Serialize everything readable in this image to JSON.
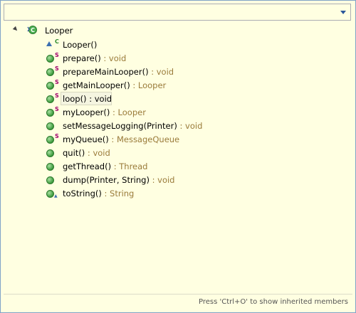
{
  "root": {
    "label": "Looper"
  },
  "members": [
    {
      "name": "Looper()",
      "type": "",
      "icon": "constructor",
      "modifier": "C"
    },
    {
      "name": "prepare()",
      "type": " : void",
      "icon": "public-method",
      "modifier": "S"
    },
    {
      "name": "prepareMainLooper()",
      "type": " : void",
      "icon": "public-method",
      "modifier": "S"
    },
    {
      "name": "getMainLooper()",
      "type": " : Looper",
      "icon": "public-method",
      "modifier": "S"
    },
    {
      "name": "loop()",
      "type": " : void",
      "icon": "public-method",
      "modifier": "S",
      "selected": true
    },
    {
      "name": "myLooper()",
      "type": " : Looper",
      "icon": "public-method",
      "modifier": "S"
    },
    {
      "name": "setMessageLogging(Printer)",
      "type": " : void",
      "icon": "public-method",
      "modifier": ""
    },
    {
      "name": "myQueue()",
      "type": " : MessageQueue",
      "icon": "public-method",
      "modifier": "S"
    },
    {
      "name": "quit()",
      "type": " : void",
      "icon": "public-method",
      "modifier": ""
    },
    {
      "name": "getThread()",
      "type": " : Thread",
      "icon": "public-method",
      "modifier": ""
    },
    {
      "name": "dump(Printer, String)",
      "type": " : void",
      "icon": "public-method",
      "modifier": ""
    },
    {
      "name": "toString()",
      "type": " : String",
      "icon": "public-method",
      "modifier": "override"
    }
  ],
  "status": {
    "hint": "Press 'Ctrl+O' to show inherited members"
  },
  "colors": {
    "background": "#ffffe1",
    "border": "#7fa3c8",
    "type_text": "#9a7b3a",
    "static_marker": "#a0006a"
  }
}
